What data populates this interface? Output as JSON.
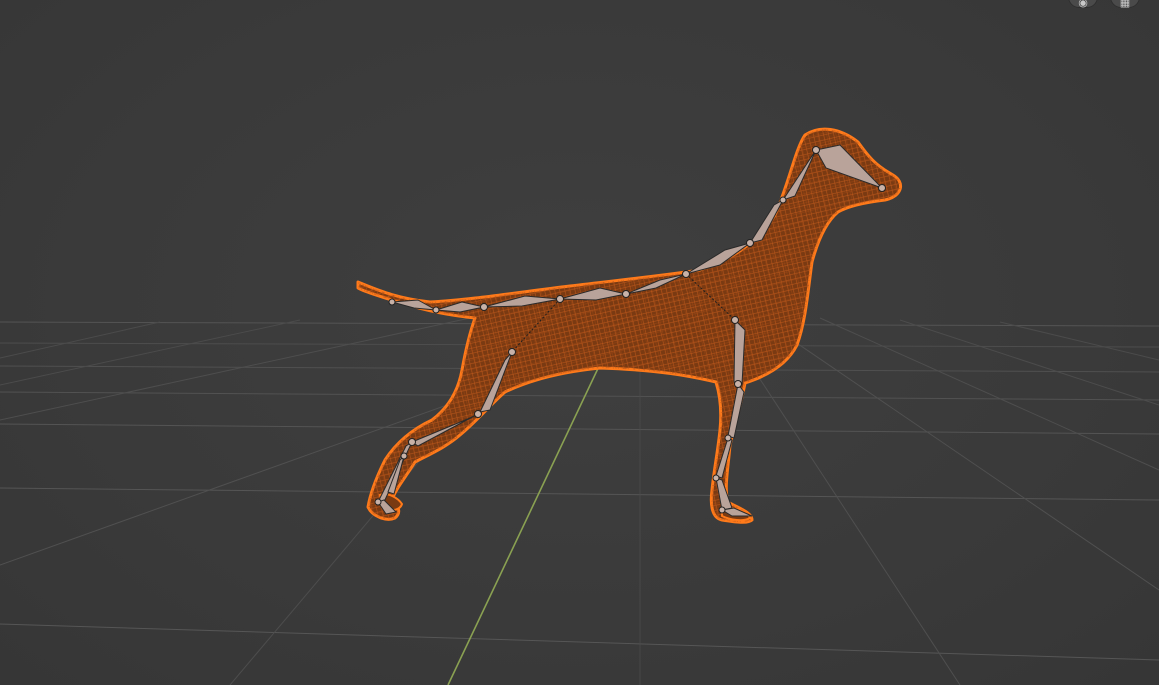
{
  "viewport": {
    "background_color": "#3a3a3a",
    "grid_line_color": "#545454",
    "y_axis_color": "#8aa152",
    "selection_outline_color": "#ff7a1a",
    "mesh_fill_color": "#7a3a12",
    "bone_color": "#b9a39a",
    "bone_outline_color": "#2a2a2a"
  },
  "scene": {
    "object": "dog-mesh",
    "armature": "dog-armature",
    "display_mode": "wireframe"
  },
  "header_buttons": [
    {
      "name": "view-camera-button",
      "icon": "camera-icon"
    },
    {
      "name": "view-perspective-button",
      "icon": "grid-icon"
    }
  ]
}
